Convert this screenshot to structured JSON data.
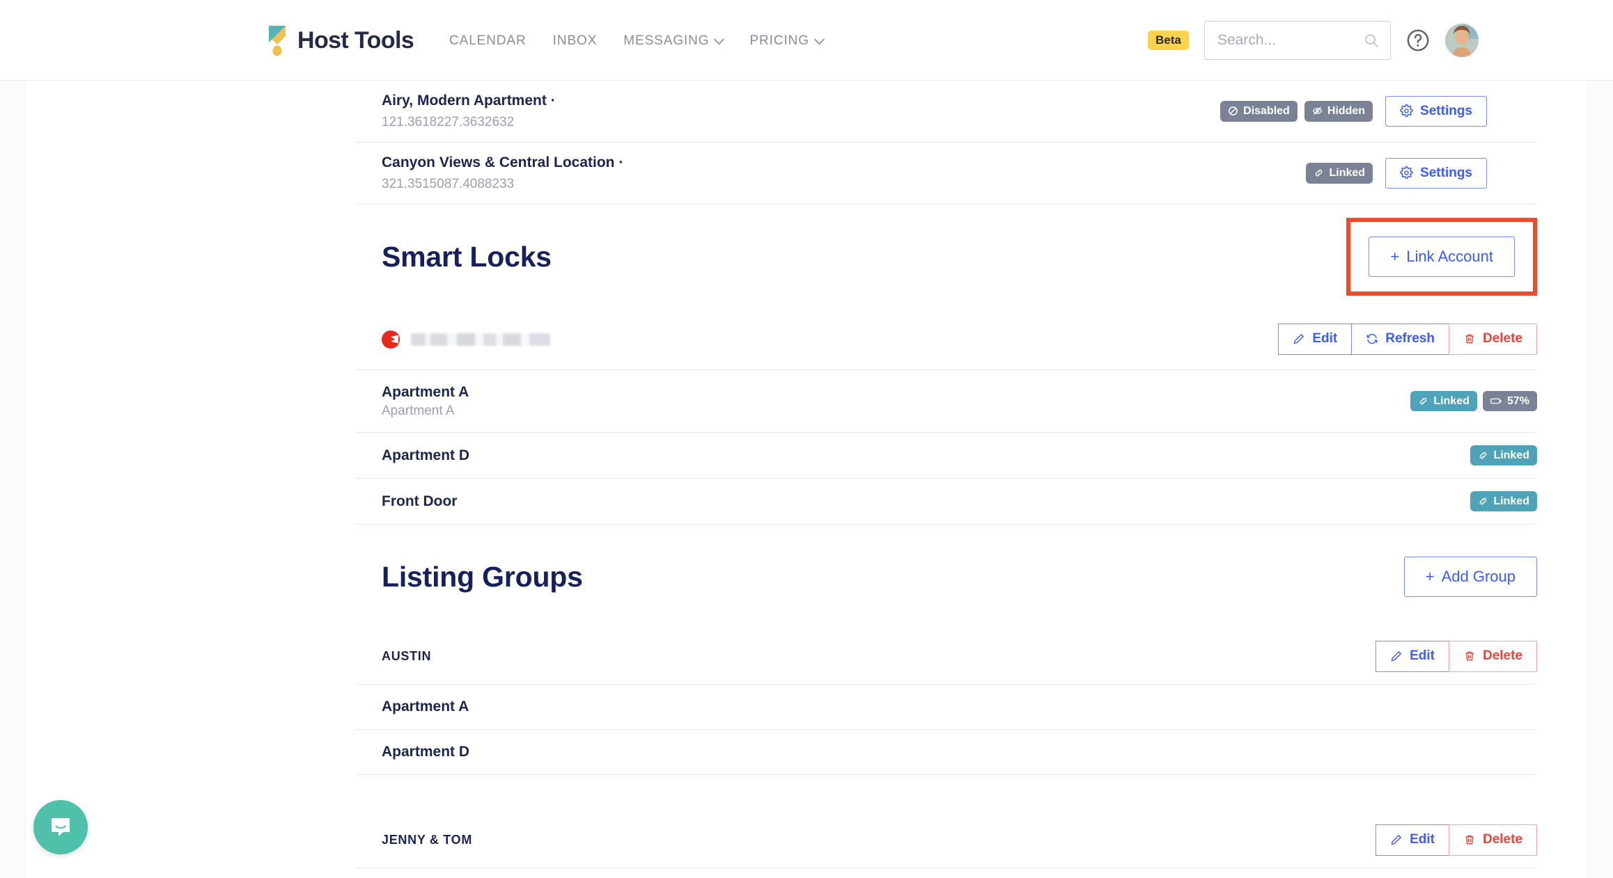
{
  "header": {
    "brand": "Host Tools",
    "logo_icon": "host-tools-trophy-logo",
    "nav": [
      {
        "label": "CALENDAR",
        "has_dropdown": false
      },
      {
        "label": "INBOX",
        "has_dropdown": false
      },
      {
        "label": "MESSAGING",
        "has_dropdown": true
      },
      {
        "label": "PRICING",
        "has_dropdown": true
      }
    ],
    "beta_label": "Beta",
    "search_placeholder": "Search...",
    "search_value": "",
    "search_icon": "search-icon",
    "help_icon": "help-circle-icon",
    "avatar_icon": "user-avatar"
  },
  "listings": [
    {
      "title": "Airy, Modern Apartment ·",
      "subtitle": "121.3618227.3632632",
      "badges": [
        {
          "label": "Disabled",
          "icon": "no-entry-icon",
          "color": "#7b8296"
        },
        {
          "label": "Hidden",
          "icon": "eye-off-icon",
          "color": "#7b8296"
        }
      ],
      "settings_label": "Settings",
      "settings_icon": "gear-icon"
    },
    {
      "title": "Canyon Views & Central Location ·",
      "subtitle": "321.3515087.4088233",
      "badges": [
        {
          "label": "Linked",
          "icon": "link-icon",
          "color": "#7b8296"
        }
      ],
      "settings_label": "Settings",
      "settings_icon": "gear-icon"
    }
  ],
  "smart_locks": {
    "heading": "Smart Locks",
    "link_account_label": "Link Account",
    "link_account_plus": "+",
    "highlight_color": "#ef4a2b",
    "account_row": {
      "brand_icon": "lock-brand-logo",
      "name_redacted": true,
      "actions": [
        {
          "label": "Edit",
          "icon": "pencil-icon",
          "style": "primary"
        },
        {
          "label": "Refresh",
          "icon": "refresh-icon",
          "style": "primary"
        },
        {
          "label": "Delete",
          "icon": "trash-icon",
          "style": "danger"
        }
      ]
    },
    "locks": [
      {
        "name": "Apartment A",
        "subtitle": "Apartment A",
        "badges": [
          {
            "label": "Linked",
            "icon": "link-icon",
            "color": "#4ea3b8"
          },
          {
            "label": "57%",
            "icon": "battery-icon",
            "color": "#7b8296"
          }
        ]
      },
      {
        "name": "Apartment D",
        "subtitle": "",
        "badges": [
          {
            "label": "Linked",
            "icon": "link-icon",
            "color": "#4ea3b8"
          }
        ]
      },
      {
        "name": "Front Door",
        "subtitle": "",
        "badges": [
          {
            "label": "Linked",
            "icon": "link-icon",
            "color": "#4ea3b8"
          }
        ]
      }
    ]
  },
  "listing_groups": {
    "heading": "Listing Groups",
    "add_group_label": "Add Group",
    "add_group_plus": "+",
    "groups": [
      {
        "name": "AUSTIN",
        "actions": [
          {
            "label": "Edit",
            "icon": "pencil-icon",
            "style": "primary"
          },
          {
            "label": "Delete",
            "icon": "trash-icon",
            "style": "danger"
          }
        ],
        "items": [
          {
            "name": "Apartment A"
          },
          {
            "name": "Apartment D"
          }
        ]
      },
      {
        "name": "JENNY & TOM",
        "actions": [
          {
            "label": "Edit",
            "icon": "pencil-icon",
            "style": "primary"
          },
          {
            "label": "Delete",
            "icon": "trash-icon",
            "style": "danger"
          }
        ],
        "items": []
      }
    ]
  },
  "chat_widget": {
    "icon": "intercom-chat-icon",
    "color": "#4fc1ab"
  }
}
